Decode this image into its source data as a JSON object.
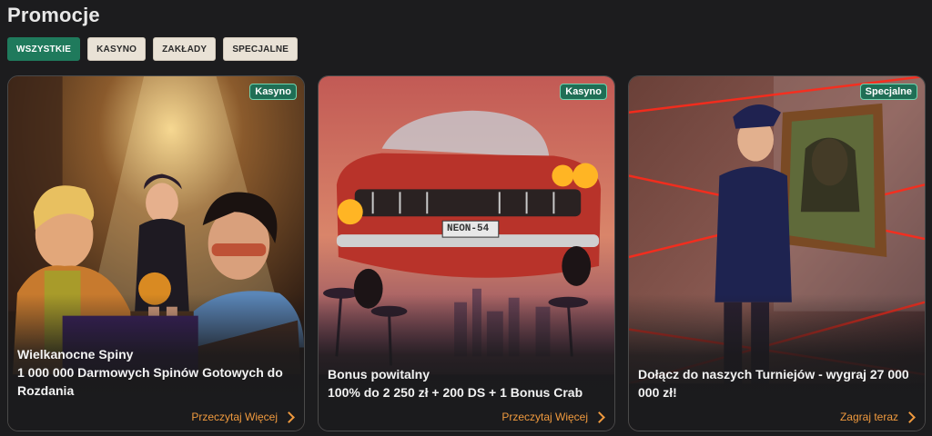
{
  "page": {
    "title": "Promocje"
  },
  "filters": [
    {
      "label": "WSZYSTKIE",
      "active": true
    },
    {
      "label": "KASYNO",
      "active": false
    },
    {
      "label": "ZAKŁADY",
      "active": false
    },
    {
      "label": "SPECJALNE",
      "active": false
    }
  ],
  "cards": [
    {
      "badge": "Kasyno",
      "line1": "Wielkanocne Spiny",
      "line2": "1 000 000 Darmowych Spinów Gotowych do Rozdania",
      "cta": "Przeczytaj Więcej"
    },
    {
      "badge": "Kasyno",
      "line1": "Bonus powitalny",
      "line2": "100% do 2 250 zł + 200 DS + 1 Bonus Crab",
      "cta": "Przeczytaj Więcej",
      "plate": "NEON-54"
    },
    {
      "badge": "Specjalne",
      "line1": "Dołącz do naszych Turniejów - wygraj 27 000 000 zł!",
      "line2": "",
      "cta": "Zagraj teraz"
    }
  ],
  "colors": {
    "accent_green": "#1f7a5c",
    "cta_orange": "#f09a3e",
    "background": "#1c1c1e"
  }
}
